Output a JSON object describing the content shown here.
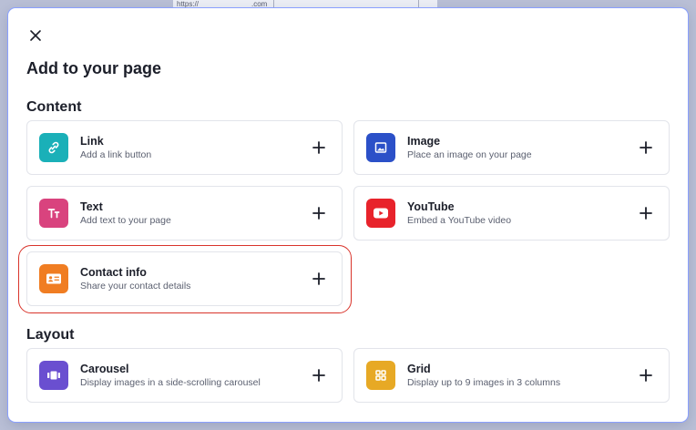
{
  "background": {
    "url_fragment_1": "https://",
    "url_fragment_2": ".com"
  },
  "modal": {
    "title": "Add to your page",
    "close_icon": "close-icon"
  },
  "content_section": {
    "heading": "Content",
    "items": [
      {
        "label": "Link",
        "description": "Add a link button",
        "icon": "link-icon",
        "color": "#1ab0b8"
      },
      {
        "label": "Image",
        "description": "Place an image on your page",
        "icon": "image-icon",
        "color": "#2b50c8"
      },
      {
        "label": "Text",
        "description": "Add text to your page",
        "icon": "text-icon",
        "color": "#d9437e"
      },
      {
        "label": "YouTube",
        "description": "Embed a YouTube video",
        "icon": "youtube-icon",
        "color": "#e8232b"
      },
      {
        "label": "Contact info",
        "description": "Share your contact details",
        "icon": "contact-card-icon",
        "color": "#f07d22"
      }
    ]
  },
  "layout_section": {
    "heading": "Layout",
    "items": [
      {
        "label": "Carousel",
        "description": "Display images in a side-scrolling carousel",
        "icon": "carousel-icon",
        "color": "#6a4fd0"
      },
      {
        "label": "Grid",
        "description": "Display up to 9 images in 3 columns",
        "icon": "grid-icon",
        "color": "#e7a925"
      }
    ]
  },
  "highlight": {
    "target": "Contact info",
    "color": "#d9342b"
  },
  "add_icon": "plus-icon"
}
